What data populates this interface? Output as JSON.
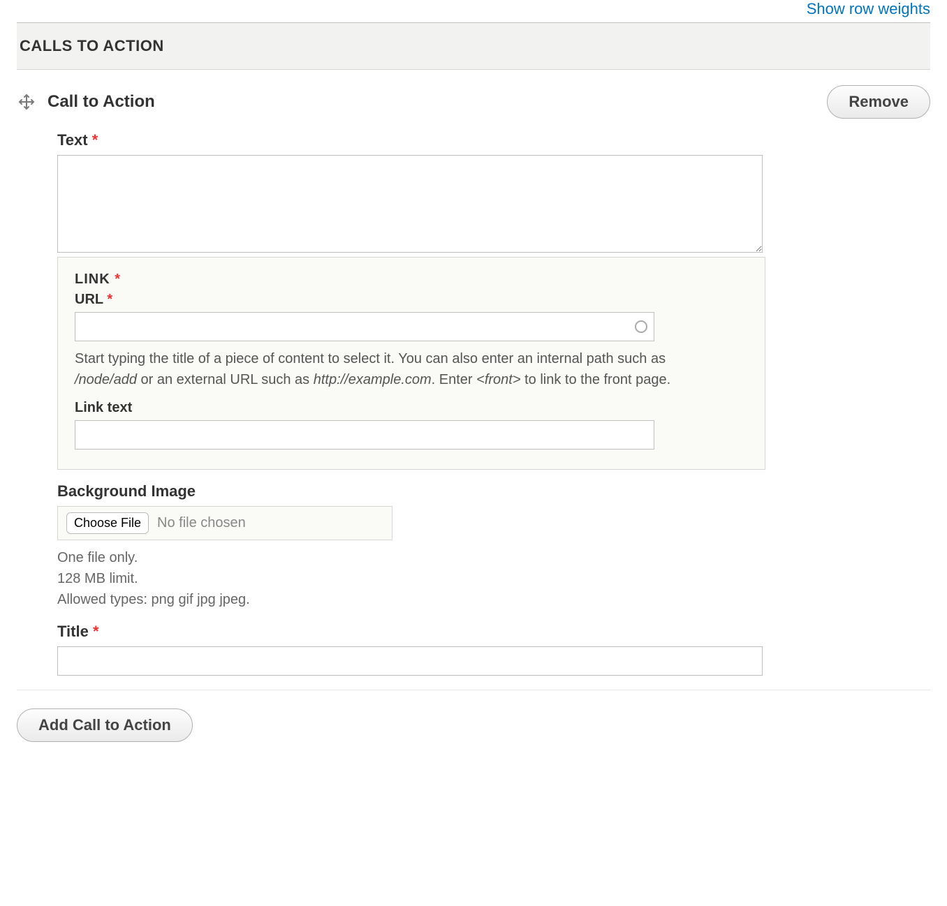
{
  "toolbar": {
    "show_row_weights": "Show row weights"
  },
  "section": {
    "title": "CALLS TO ACTION",
    "add_button": "Add Call to Action"
  },
  "item": {
    "heading": "Call to Action",
    "remove_button": "Remove",
    "fields": {
      "text": {
        "label": "Text",
        "value": ""
      },
      "link": {
        "legend": "LINK",
        "url_label": "URL",
        "url_value": "",
        "url_help_pre": "Start typing the title of a piece of content to select it. You can also enter an internal path such as ",
        "url_help_path": "/node/add",
        "url_help_mid": " or an external URL such as ",
        "url_help_url": "http://example.com",
        "url_help_enter": ". Enter ",
        "url_help_front": "<front>",
        "url_help_post": " to link to the front page.",
        "link_text_label": "Link text",
        "link_text_value": ""
      },
      "background_image": {
        "label": "Background Image",
        "choose_file_button": "Choose File",
        "file_status": "No file chosen",
        "desc_one_file": "One file only.",
        "desc_limit": "128 MB limit.",
        "desc_types": "Allowed types: png gif jpg jpeg."
      },
      "title": {
        "label": "Title",
        "value": ""
      }
    }
  }
}
